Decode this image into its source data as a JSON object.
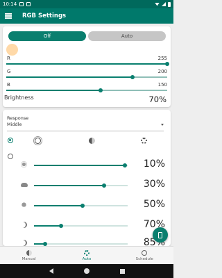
{
  "status_bar": {
    "time": "10:14"
  },
  "app_bar": {
    "title": "RGB Settings",
    "menu_icon": "menu-icon"
  },
  "mode_toggle": {
    "off_label": "Off",
    "auto_label": "Auto",
    "selected": "Off"
  },
  "color_preview": {
    "color": "#ffd9a8"
  },
  "rgb": {
    "r": {
      "label": "R",
      "value": "255",
      "fraction": 1.0
    },
    "g": {
      "label": "G",
      "value": "200",
      "fraction": 0.784
    },
    "b": {
      "label": "B",
      "value": "150",
      "fraction": 0.588
    }
  },
  "brightness": {
    "label": "Brightness",
    "value": "70%",
    "fraction": 0.7
  },
  "response": {
    "label": "Response",
    "selected": "Middle"
  },
  "mode_icons": [
    "brightness-auto-icon",
    "brightness-outline-icon",
    "contrast-icon",
    "settings-icon"
  ],
  "intensity_rows": [
    {
      "icon": "sun-icon",
      "value": "10%",
      "fraction": 0.97
    },
    {
      "icon": "cloud-icon",
      "value": "30%",
      "fraction": 0.75
    },
    {
      "icon": "lightbulb-icon",
      "value": "50%",
      "fraction": 0.52
    },
    {
      "icon": "moon-icon",
      "value": "70%",
      "fraction": 0.29
    },
    {
      "icon": "moon-icon",
      "value": "85%",
      "fraction": 0.12
    }
  ],
  "fab": {
    "icon": "phone-icon"
  },
  "bottom_nav": [
    {
      "label": "Manual",
      "icon": "contrast-icon",
      "active": false
    },
    {
      "label": "Auto",
      "icon": "settings-icon",
      "active": true
    },
    {
      "label": "Schedule",
      "icon": "alarm-icon",
      "active": false
    }
  ],
  "colors": {
    "primary": "#00796b",
    "status_bar": "#00695c",
    "accent": "#0a7f6f"
  }
}
